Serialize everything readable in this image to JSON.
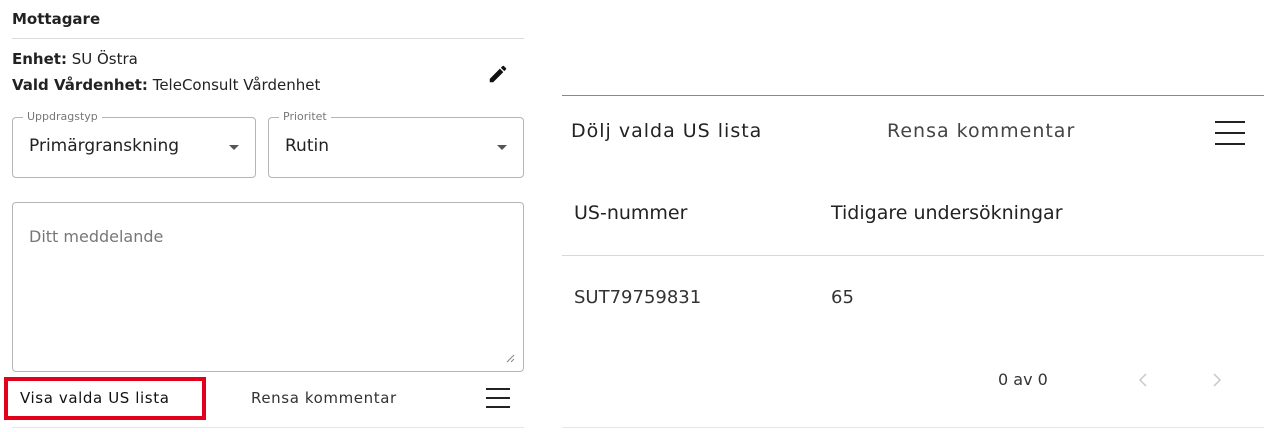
{
  "recipient": {
    "section_title": "Mottagare",
    "unit_label": "Enhet:",
    "unit_value": "SU Östra",
    "care_unit_label": "Vald Vårdenhet:",
    "care_unit_value": "TeleConsult Vårdenhet",
    "edit_icon": "pencil-icon"
  },
  "form": {
    "assignment_type": {
      "legend": "Uppdragstyp",
      "value": "Primärgranskning"
    },
    "priority": {
      "legend": "Prioritet",
      "value": "Rutin"
    },
    "message": {
      "placeholder": "Ditt meddelande",
      "value": ""
    }
  },
  "left_toolbar": {
    "show_list_label": "Visa valda US lista",
    "clear_comment_label": "Rensa kommentar",
    "menu_icon": "hamburger-menu-icon",
    "highlight_color": "#e3001b"
  },
  "right_toolbar": {
    "hide_list_label": "Dölj valda US lista",
    "clear_comment_label": "Rensa kommentar",
    "menu_icon": "hamburger-menu-icon"
  },
  "table": {
    "columns": [
      "US-nummer",
      "Tidigare undersökningar"
    ],
    "rows": [
      [
        "SUT79759831",
        "65"
      ]
    ]
  },
  "pagination": {
    "range_text": "0 av 0",
    "prev_icon": "chevron-left-icon",
    "next_icon": "chevron-right-icon"
  }
}
